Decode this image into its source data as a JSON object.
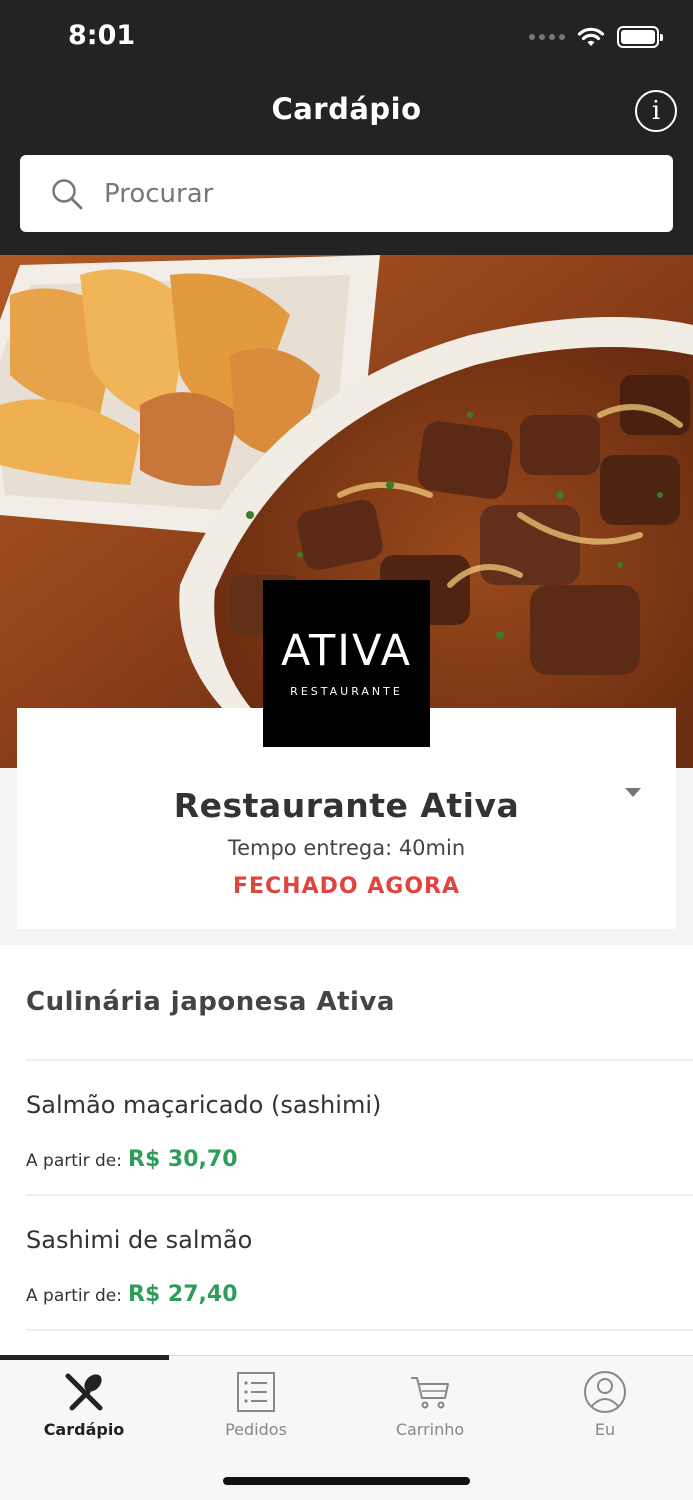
{
  "status_bar": {
    "time": "8:01"
  },
  "nav": {
    "title": "Cardápio",
    "info_icon": "info-icon"
  },
  "search": {
    "placeholder": "Procurar",
    "icon": "search-icon"
  },
  "restaurant": {
    "logo_text": "ATIVA",
    "logo_subtext": "RESTAURANTE",
    "name": "Restaurante Ativa",
    "delivery_time": "Tempo entrega: 40min",
    "status": "FECHADO AGORA",
    "status_color": "#e0443e"
  },
  "menu": {
    "category": "Culinária japonesa Ativa",
    "items": [
      {
        "name": "Salmão maçaricado (sashimi)",
        "price_prefix": "A partir de:",
        "price": "R$ 30,70"
      },
      {
        "name": "Sashimi de salmão",
        "price_prefix": "A partir de:",
        "price": "R$ 27,40"
      }
    ],
    "price_color": "#2e9d5a"
  },
  "tabs": [
    {
      "label": "Cardápio",
      "icon": "fork-knife-icon",
      "active": true
    },
    {
      "label": "Pedidos",
      "icon": "list-icon",
      "active": false
    },
    {
      "label": "Carrinho",
      "icon": "cart-icon",
      "active": false
    },
    {
      "label": "Eu",
      "icon": "user-icon",
      "active": false
    }
  ]
}
